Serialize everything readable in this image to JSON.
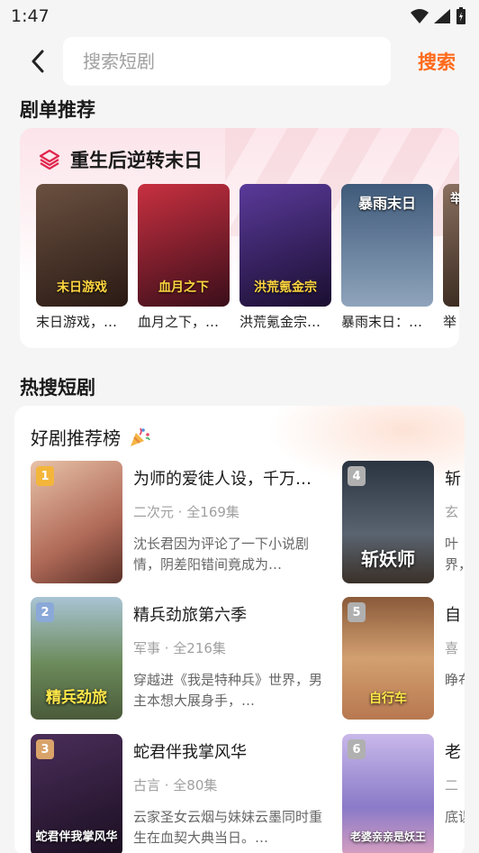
{
  "status": {
    "time": "1:47"
  },
  "header": {
    "search_placeholder": "搜索短剧",
    "search_label": "搜索"
  },
  "sections": {
    "recommend_title": "剧单推荐",
    "hot_title": "热搜短剧"
  },
  "recommend": {
    "title": "重生后逆转末日",
    "items": [
      {
        "caption": "末日游戏，…",
        "poster_text": "末日游戏",
        "color": "#3a2a22"
      },
      {
        "caption": "血月之下，…",
        "poster_text": "血月之下",
        "color": "#5a1a28"
      },
      {
        "caption": "洪荒氪金宗…",
        "poster_text": "洪荒氪金宗",
        "color": "#2a1a4a"
      },
      {
        "caption": "暴雨末日：…",
        "poster_text": "暴雨末日",
        "color": "#5a7290"
      },
      {
        "caption": "举",
        "poster_text": "举",
        "color": "#6a5a50"
      }
    ]
  },
  "hot": {
    "panel_title": "好剧推荐榜",
    "left": [
      {
        "rank": "1",
        "name": "为师的爱徒人设，千万…",
        "meta": "二次元 · 全169集",
        "desc": "沈长君因为评论了一下小说剧情，阴差阳错间竟成为…",
        "cover_color": "#d9a88e",
        "badge_color": "#f3b63a"
      },
      {
        "rank": "2",
        "name": "精兵劲旅第六季",
        "meta": "军事 · 全216集",
        "desc": "穿越进《我是特种兵》世界，男主本想大展身手，…",
        "cover_color": "#7fa6b8",
        "badge_color": "#8aa8d8",
        "cover_text": "精兵劲旅"
      },
      {
        "rank": "3",
        "name": "蛇君伴我掌风华",
        "meta": "古言 · 全80集",
        "desc": "云家圣女云烟与妹妹云墨同时重生在血契大典当日。…",
        "cover_color": "#3a2440",
        "badge_color": "#d9a36a",
        "cover_text": "蛇君伴我掌风华"
      }
    ],
    "right": [
      {
        "rank": "4",
        "name": "斩",
        "meta": "玄",
        "desc": "叶界，",
        "cover_color": "#3a4450",
        "badge_color": "#b0b0b0",
        "cover_text": "斩妖师"
      },
      {
        "rank": "5",
        "name": "自",
        "meta": "喜",
        "desc": "睁布",
        "cover_color": "#c89a70",
        "badge_color": "#b0b0b0",
        "cover_text": "自行车"
      },
      {
        "rank": "6",
        "name": "老",
        "meta": "二",
        "desc": "底误",
        "cover_color": "#a99ad0",
        "badge_color": "#b0b0b0",
        "cover_text": "老婆亲亲是妖王"
      }
    ]
  }
}
